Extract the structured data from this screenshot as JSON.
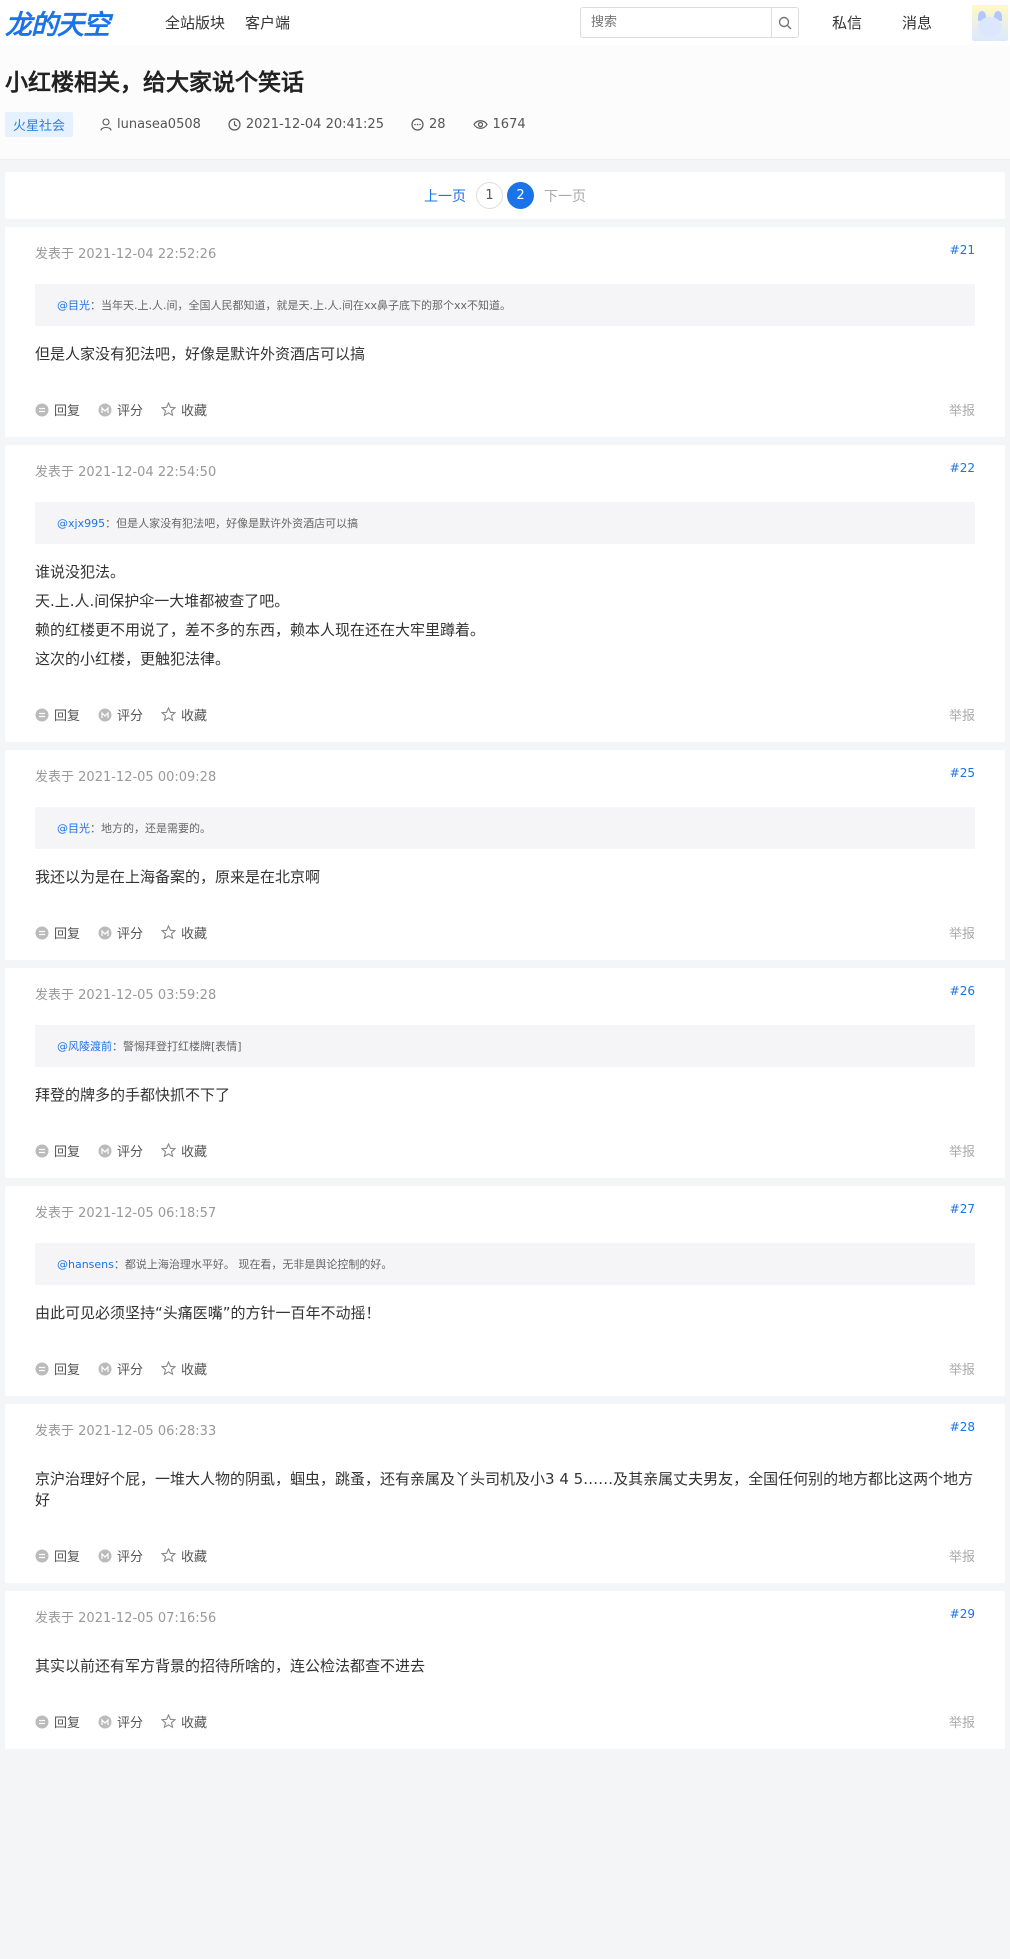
{
  "header": {
    "logo": "龙的天空",
    "nav": [
      "全站版块",
      "客户端"
    ],
    "search_placeholder": "搜索",
    "messages": "私信",
    "notifications": "消息"
  },
  "thread": {
    "title": "小红楼相关，给大家说个笑话",
    "tag": "火星社会",
    "author": "lunasea0508",
    "time": "2021-12-04 20:41:25",
    "replies": "28",
    "views": "1674"
  },
  "pager": {
    "prev": "上一页",
    "pages": [
      "1",
      "2"
    ],
    "next": "下一页"
  },
  "labels": {
    "posted_at_prefix": "发表于",
    "reply": "回复",
    "rate": "评分",
    "favorite": "收藏",
    "report": "举报"
  },
  "posts": [
    {
      "time": "2021-12-04 22:52:26",
      "num": "#21",
      "quote_user": "@目光",
      "quote_text": "：当年天.上.人.间，全国人民都知道，就是天.上.人.间在xx鼻子底下的那个xx不知道。",
      "lines": [
        "但是人家没有犯法吧，好像是默许外资酒店可以搞"
      ]
    },
    {
      "time": "2021-12-04 22:54:50",
      "num": "#22",
      "quote_user": "@xjx995",
      "quote_text": "：但是人家没有犯法吧，好像是默许外资酒店可以搞",
      "lines": [
        "谁说没犯法。",
        "天.上.人.间保护伞一大堆都被查了吧。",
        "赖的红楼更不用说了，差不多的东西，赖本人现在还在大牢里蹲着。",
        "这次的小红楼，更触犯法律。"
      ]
    },
    {
      "time": "2021-12-05 00:09:28",
      "num": "#25",
      "quote_user": "@目光",
      "quote_text": "：地方的，还是需要的。",
      "lines": [
        "我还以为是在上海备案的，原来是在北京啊"
      ]
    },
    {
      "time": "2021-12-05 03:59:28",
      "num": "#26",
      "quote_user": "@风陵渡前",
      "quote_text": "：警惕拜登打红楼牌[表情]",
      "lines": [
        "拜登的牌多的手都快抓不下了"
      ]
    },
    {
      "time": "2021-12-05 06:18:57",
      "num": "#27",
      "quote_user": "@hansens",
      "quote_text": "：都说上海治理水平好。 现在看，无非是舆论控制的好。",
      "lines": [
        "由此可见必须坚持“头痛医嘴”的方针一百年不动摇！"
      ]
    },
    {
      "time": "2021-12-05 06:28:33",
      "num": "#28",
      "lines": [
        "京沪治理好个屁，一堆大人物的阴虱，蝈虫，跳蚤，还有亲属及丫头司机及小3 4 5……及其亲属丈夫男友，全国任何别的地方都比这两个地方好"
      ]
    },
    {
      "time": "2021-12-05 07:16:56",
      "num": "#29",
      "lines": [
        "其实以前还有军方背景的招待所啥的，连公检法都查不进去"
      ]
    }
  ]
}
